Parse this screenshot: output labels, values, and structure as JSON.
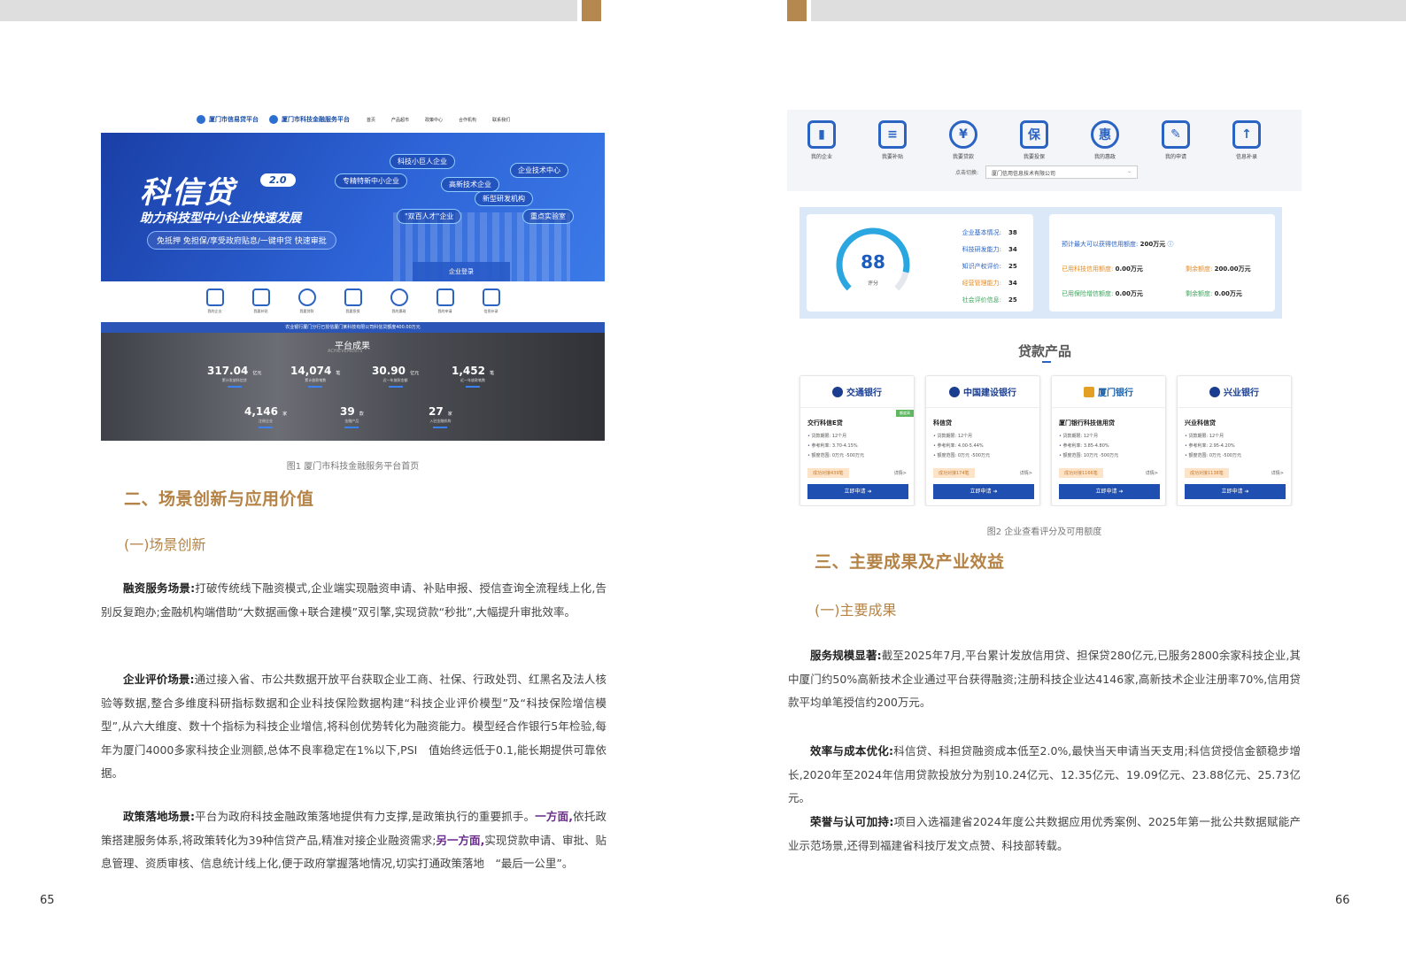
{
  "page_left": {
    "page_number": "65",
    "figure1": {
      "caption": "图1 厦门市科技金融服务平台首页",
      "logo1": "厦门市信易贷平台",
      "logo2": "厦门市科技金融服务平台",
      "nav": [
        "首页",
        "产品超市",
        "政策中心",
        "合作机构",
        "联系我们"
      ],
      "banner": {
        "title": "科信贷",
        "version": "2.0",
        "subtitle": "助力科技型中小企业快速发展",
        "slogan": "免抵押 免担保/享受政府贴息/一键申贷 快速审批",
        "tags": [
          "科技小巨人企业",
          "企业技术中心",
          "专精特新中小企业",
          "高新技术企业",
          "新型研发机构",
          "\"双百人才\"企业",
          "重点实验室"
        ],
        "login": "企业登录"
      },
      "icons": [
        "我的企业",
        "我要补贴",
        "我要贷款",
        "我要投保",
        "我的惠政",
        "我的申请",
        "信息补录"
      ],
      "notice": "农业银行厦门分行已授信厦门某科技有限公司科信贷额度400.00万元",
      "achievements": {
        "title": "平台成果",
        "subtitle": "ACHIEVEMENTS",
        "stats": [
          {
            "value": "317.04",
            "unit": "亿元",
            "label": "累计发放科信贷"
          },
          {
            "value": "14,074",
            "unit": "笔",
            "label": "累计放款笔数"
          },
          {
            "value": "30.90",
            "unit": "亿元",
            "label": "近一年放款金额"
          },
          {
            "value": "1,452",
            "unit": "笔",
            "label": "近一年放款笔数"
          },
          {
            "value": "4,146",
            "unit": "家",
            "label": "注册企业"
          },
          {
            "value": "39",
            "unit": "款",
            "label": "金融产品"
          },
          {
            "value": "27",
            "unit": "家",
            "label": "入驻金融机构"
          }
        ]
      }
    },
    "section_title": "二、场景创新与应用价值",
    "subsection_title": "(一)场景创新",
    "paragraphs": [
      {
        "lead": "融资服务场景:",
        "text": "打破传统线下融资模式,企业端实现融资申请、补贴申报、授信查询全流程线上化,告别反复跑办;金融机构端借助“大数据画像+联合建模”双引擎,实现贷款“秒批”,大幅提升审批效率。"
      },
      {
        "lead": "企业评价场景:",
        "text": "通过接入省、市公共数据开放平台获取企业工商、社保、行政处罚、红黑名及法人核验等数据,整合多维度科研指标数据和企业科技保险数据构建“科技企业评价模型”及“科技保险增信模型”,从六大维度、数十个指标为科技企业增信,将科创优势转化为融资能力。模型经合作银行5年检验,每年为厦门4000多家科技企业测额,总体不良率稳定在1%以下,PSI　值始终远低于0.1,能长期提供可靠依据。"
      },
      {
        "lead": "政策落地场景:",
        "text1": "平台为政府科技金融政策落地提供有力支撑,是政策执行的重要抓手。",
        "hl1": "一方面,",
        "text2": "依托政策搭建服务体系,将政策转化为39种信贷产品,精准对接企业融资需求;",
        "hl2": "另一方面,",
        "text3": "实现贷款申请、审批、贴息管理、资质审核、信息统计线上化,便于政府掌握落地情况,切实打通政策落地　“最后一公里”。"
      }
    ]
  },
  "page_right": {
    "page_number": "66",
    "figure2": {
      "caption": "图2 企业查看评分及可用额度",
      "icons": [
        "我的企业",
        "我要补贴",
        "我要贷款",
        "我要投保",
        "我的惠政",
        "我的申请",
        "信息补录"
      ],
      "switch_label": "点击切换:",
      "company": "厦门信用信息技术有限公司",
      "score": {
        "value": 88,
        "label": "评分",
        "max": 100
      },
      "metrics": [
        {
          "name": "企业基本情况:",
          "value": "38",
          "color": "#2a63c4"
        },
        {
          "name": "科技研发能力:",
          "value": "34",
          "color": "#2a63c4"
        },
        {
          "name": "知识产权评价:",
          "value": "25",
          "color": "#2a63c4"
        },
        {
          "name": "经营管理能力:",
          "value": "34",
          "color": "#e88a1e"
        },
        {
          "name": "社会评价信息:",
          "value": "25",
          "color": "#3aa65a"
        }
      ],
      "credit": {
        "max_label": "预计最大可以获得信用额度:",
        "max_value": "200万元",
        "used_credit_label": "已用科技信用额度:",
        "used_credit": "0.00万元",
        "remain_label1": "剩余额度:",
        "remain1": "200.00万元",
        "used_ins_label": "已用保险增信额度:",
        "used_ins": "0.00万元",
        "remain_label2": "剩余额度:",
        "remain2": "0.00万元"
      },
      "products_title": "贷款产品",
      "banks": [
        {
          "bank": "交通银行",
          "color": "#1a3d8f",
          "product": "交行科信E贷",
          "term": "贷款期限: 12个月",
          "rate": "参考利率: 3.70-4.15%",
          "range": "额度范围: 0万元 -500万元",
          "success": "成功对接439笔",
          "detail": "详情>",
          "apply": "立即申请 ➔",
          "badge": "额度高"
        },
        {
          "bank": "中国建设银行",
          "color": "#1a3d8f",
          "product": "科信贷",
          "term": "贷款期限: 12个月",
          "rate": "参考利率: 4.00-5.44%",
          "range": "额度范围: 0万元 -500万元",
          "success": "成功对接174笔",
          "detail": "详情>",
          "apply": "立即申请 ➔",
          "badge": ""
        },
        {
          "bank": "厦门银行",
          "color": "#1a5fa8",
          "product": "厦门银行科技信用贷",
          "term": "贷款期限: 12个月",
          "rate": "参考利率: 3.85-4.80%",
          "range": "额度范围: 10万元 -500万元",
          "success": "成功对接1166笔",
          "detail": "详情>",
          "apply": "立即申请 ➔",
          "badge": ""
        },
        {
          "bank": "兴业银行",
          "color": "#1a3d8f",
          "product": "兴业科信贷",
          "term": "贷款期限: 12个月",
          "rate": "参考利率: 2.95-4.20%",
          "range": "额度范围: 0万元 -500万元",
          "success": "成功对接1138笔",
          "detail": "详情>",
          "apply": "立即申请 ➔",
          "badge": ""
        }
      ]
    },
    "section_title": "三、主要成果及产业效益",
    "subsection_title": "(一)主要成果",
    "paragraphs": [
      {
        "lead": "服务规模显著:",
        "text": "截至2025年7月,平台累计发放信用贷、担保贷280亿元,已服务2800余家科技企业,其中厦门约50%高新技术企业通过平台获得融资;注册科技企业达4146家,高新技术企业注册率70%,信用贷款平均单笔授信约200万元。"
      },
      {
        "lead": "效率与成本优化:",
        "text": "科信贷、科担贷融资成本低至2.0%,最快当天申请当天支用;科信贷授信金额稳步增长,2020年至2024年信用贷款投放分为别10.24亿元、12.35亿元、19.09亿元、23.88亿元、25.73亿元。"
      },
      {
        "lead": "荣誉与认可加持:",
        "text": "项目入选福建省2024年度公共数据应用优秀案例、2025年第一批公共数据赋能产业示范场景,还得到福建省科技厅发文点赞、科技部转载。"
      }
    ]
  }
}
